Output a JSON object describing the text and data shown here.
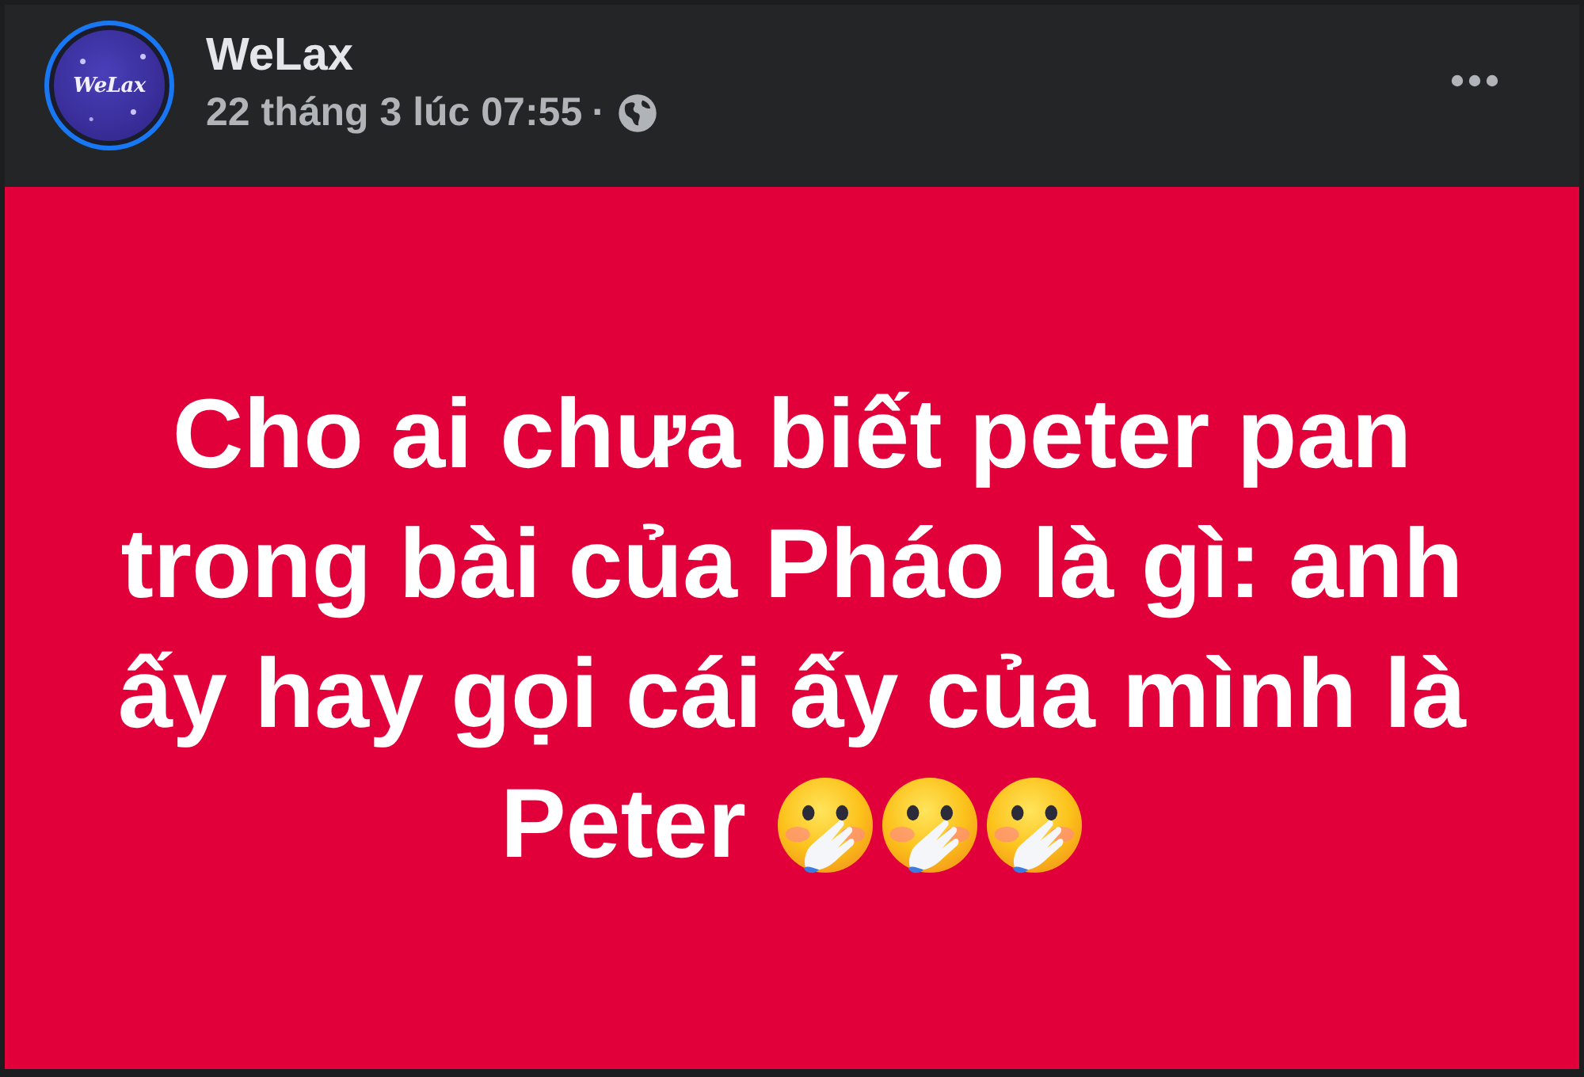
{
  "post": {
    "author": "WeLax",
    "avatar_text": "WeLax",
    "timestamp": "22 tháng 3 lúc 07:55",
    "separator": "·"
  },
  "content": {
    "text": "Cho ai chưa biết peter pan trong bài của Pháo là gì: anh ấy hay gọi cái ấy của mình là",
    "final_line": {
      "text": "Peter",
      "emojis": [
        {
          "kind": "hand-over-mouth"
        },
        {
          "kind": "hand-over-mouth"
        },
        {
          "kind": "hand-over-mouth"
        }
      ]
    }
  }
}
